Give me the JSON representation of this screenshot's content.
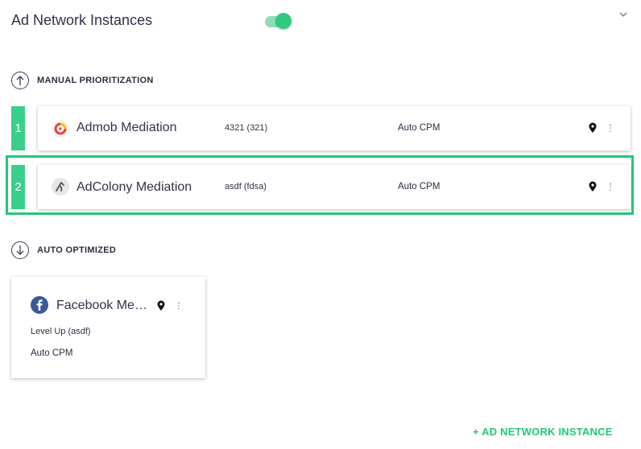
{
  "header": {
    "title": "Ad Network Instances",
    "toggle_on": true
  },
  "manual": {
    "label": "MANUAL PRIORITIZATION",
    "rows": [
      {
        "rank": "1",
        "name": "Admob Mediation",
        "instance": "4321 (321)",
        "pricing": "Auto CPM",
        "icon": "admob-icon"
      },
      {
        "rank": "2",
        "name": "AdColony Mediation",
        "instance": "asdf (fdsa)",
        "pricing": "Auto CPM",
        "icon": "adcolony-icon"
      }
    ]
  },
  "auto": {
    "label": "AUTO OPTIMIZED",
    "cards": [
      {
        "name": "Facebook Me…",
        "instance": "Level Up (asdf)",
        "pricing": "Auto CPM",
        "icon": "facebook-icon"
      }
    ]
  },
  "actions": {
    "add_instance": "+ AD NETWORK INSTANCE"
  },
  "colors": {
    "accent": "#2ecb7e",
    "rank_bg": "#38cf8b",
    "highlight": "#20c878",
    "facebook": "#3b5998"
  }
}
